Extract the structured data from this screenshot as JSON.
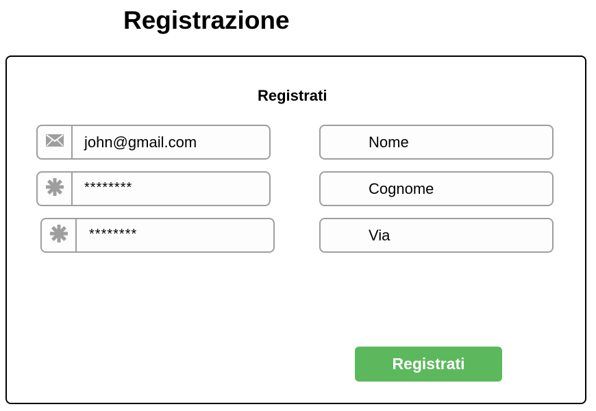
{
  "page": {
    "title": "Registrazione"
  },
  "form": {
    "title": "Registrati",
    "email": {
      "value": "john@gmail.com",
      "icon": "envelope-icon"
    },
    "password": {
      "value": "********",
      "icon": "asterisk-icon"
    },
    "password_confirm": {
      "value": "********",
      "icon": "asterisk-icon"
    },
    "nome": {
      "value": "Nome"
    },
    "cognome": {
      "value": "Cognome"
    },
    "via": {
      "value": "Via"
    },
    "submit_label": "Registrati"
  },
  "colors": {
    "submit_background": "#5cb85c",
    "field_border": "#9e9e9e",
    "icon": "#9e9e9e"
  }
}
